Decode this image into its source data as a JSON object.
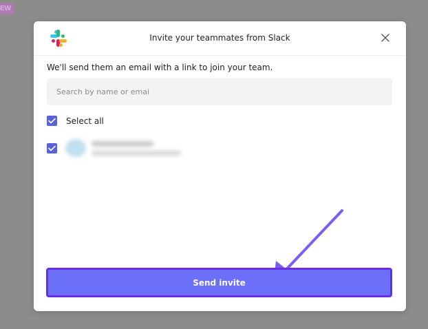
{
  "background": {
    "badge_text": "EW"
  },
  "modal": {
    "title": "Invite your teammates from Slack",
    "intro": "We'll send them an email with a link to join your team.",
    "search": {
      "placeholder": "Search by name or emai",
      "value": ""
    },
    "select_all_label": "Select all",
    "send_label": "Send invite"
  },
  "colors": {
    "accent": "#6c6ff7",
    "checkbox": "#5b61d6",
    "arrow": "#7b5cf5"
  },
  "icons": [
    "slack-logo-icon",
    "close-icon",
    "checkmark-icon",
    "arrow-pointer-icon"
  ]
}
